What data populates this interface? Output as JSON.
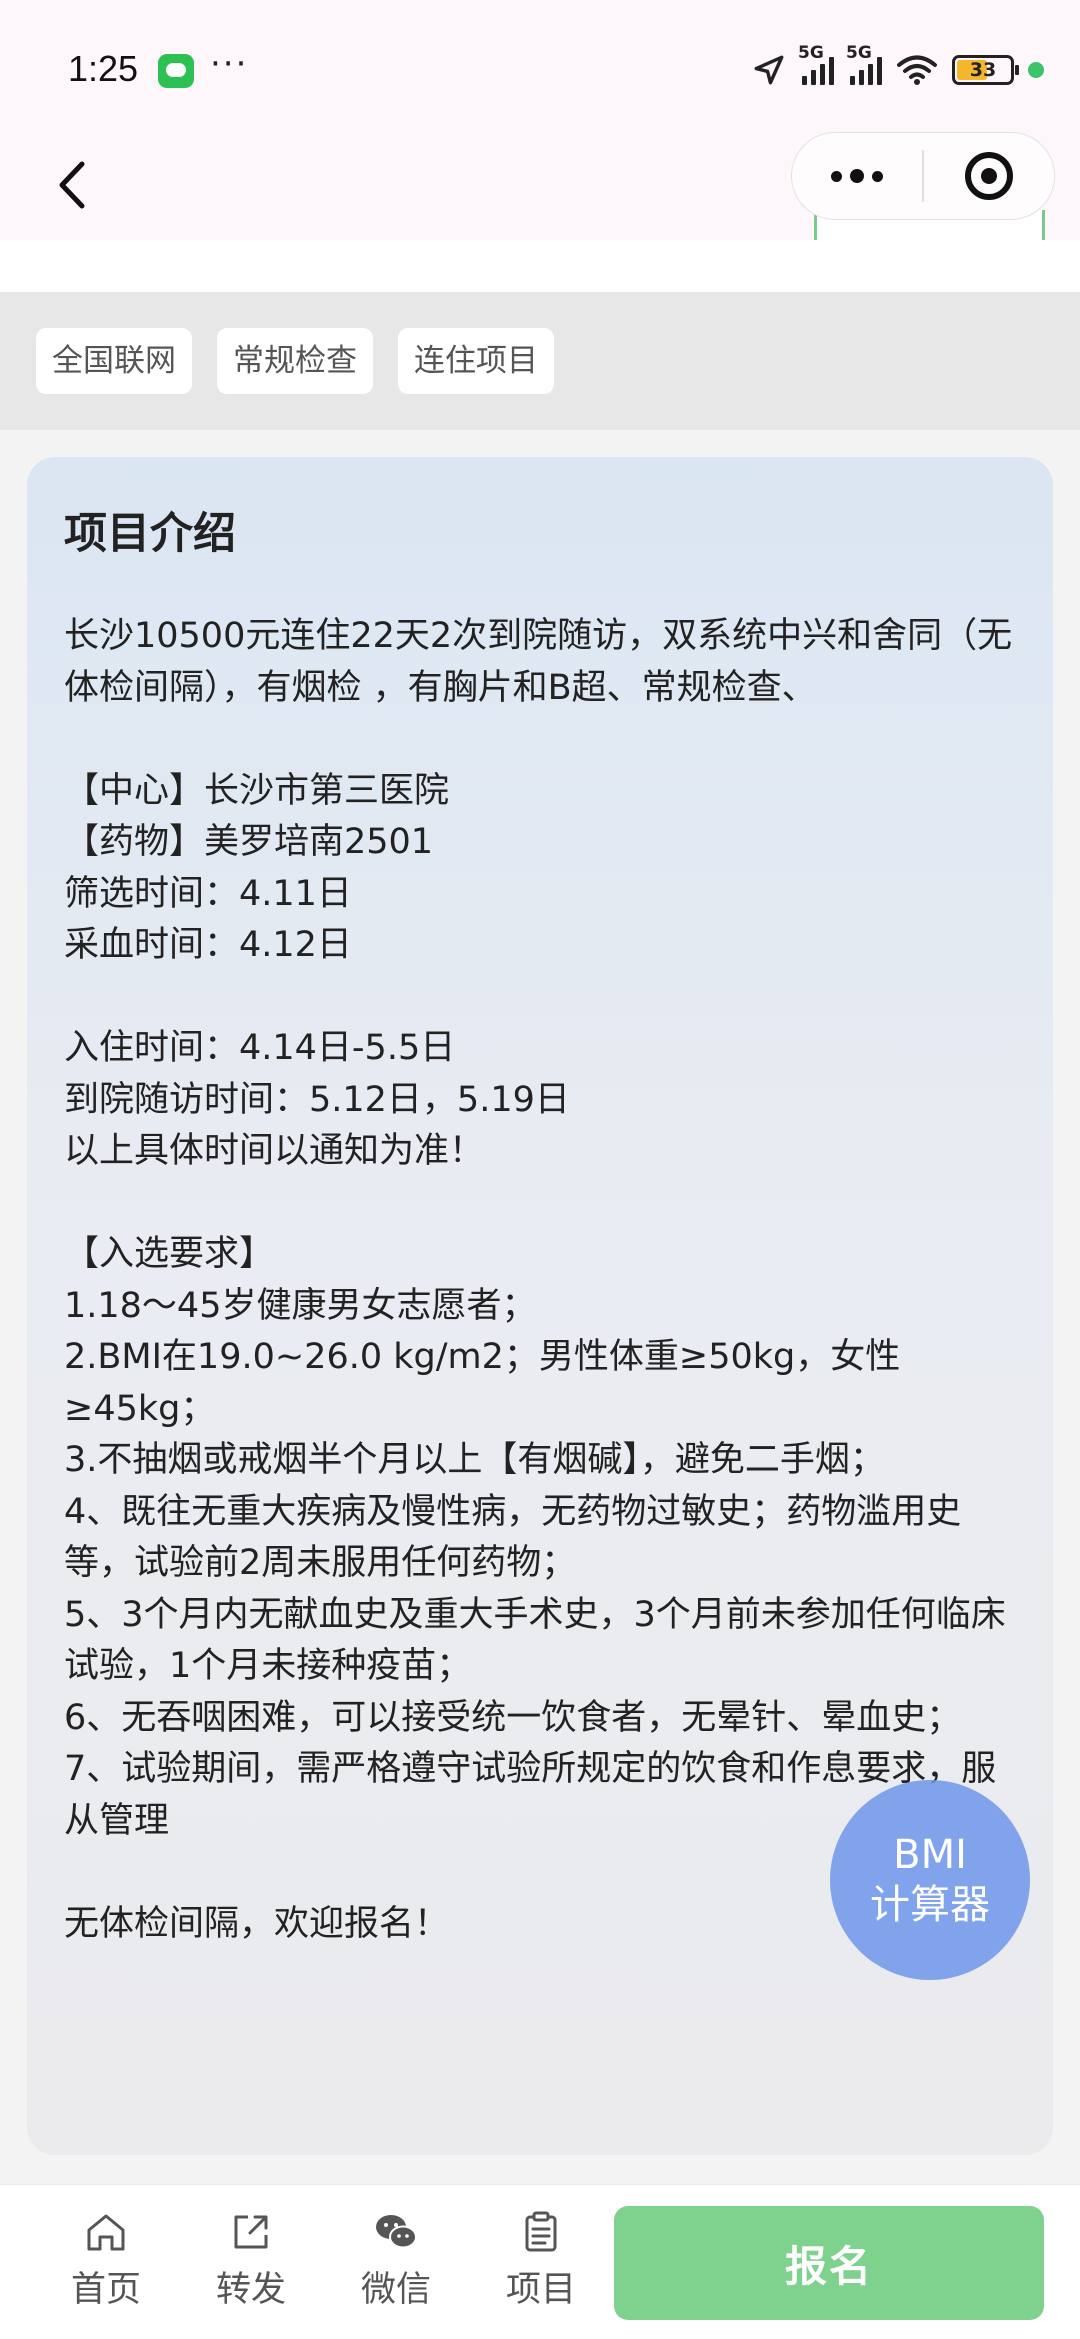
{
  "status_bar": {
    "time": "1:25",
    "more": "···",
    "network_labels": [
      "5G",
      "5G"
    ],
    "battery_level": "33",
    "icons": [
      "wechat-icon",
      "location-arrow-icon",
      "signal-icon",
      "wifi-icon",
      "battery-icon"
    ]
  },
  "nav": {
    "icons": [
      "back-arrow-icon",
      "more-dots-icon",
      "close-target-icon"
    ]
  },
  "tags": [
    "全国联网",
    "常规检查",
    "连住项目"
  ],
  "intro": {
    "title": "项目介绍",
    "body": "长沙10500元连住22天2次到院随访，双系统中兴和舍同（无体检间隔），有烟检 ，有胸片和B超、常规检查、\n\n【中心】长沙市第三医院\n【药物】美罗培南2501\n筛选时间：4.11日\n采血时间：4.12日\n\n入住时间：4.14日-5.5日\n到院随访时间：5.12日，5.19日\n以上具体时间以通知为准！\n\n【入选要求】\n1.18～45岁健康男女志愿者；\n2.BMI在19.0~26.0 kg/m2；男性体重≥50kg，女性≥45kg；\n3.不抽烟或戒烟半个月以上【有烟碱】，避免二手烟；\n4、既往无重大疾病及慢性病，无药物过敏史；药物滥用史等，试验前2周未服用任何药物；\n5、3个月内无献血史及重大手术史，3个月前未参加任何临床试验，1个月未接种疫苗；\n6、无吞咽困难，可以接受统一饮食者，无晕针、晕血史；\n7、试验期间，需严格遵守试验所规定的饮食和作息要求，服从管理\n\n无体检间隔，欢迎报名！"
  },
  "bmi_button": {
    "line1": "BMI",
    "line2": "计算器"
  },
  "bottom_bar": {
    "tabs": [
      {
        "label": "首页",
        "icon": "home-icon"
      },
      {
        "label": "转发",
        "icon": "share-icon"
      },
      {
        "label": "微信",
        "icon": "wechat-icon"
      },
      {
        "label": "项目",
        "icon": "clipboard-icon"
      }
    ],
    "signup_label": "报名"
  },
  "colors": {
    "accent_green": "#7fd28e",
    "bmi_blue": "#6e96eb",
    "status_bg": "#fdf6fb"
  }
}
